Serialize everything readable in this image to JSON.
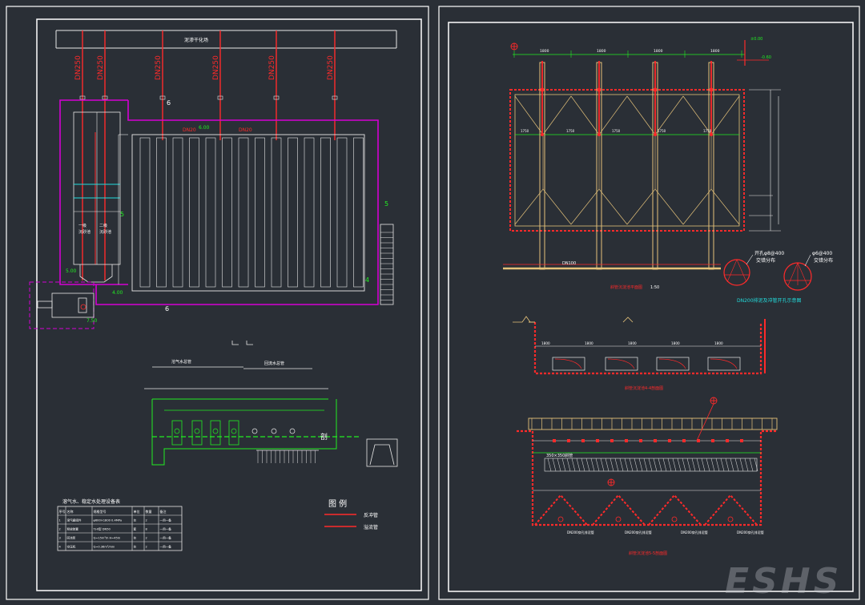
{
  "colors": {
    "background": "#2a2f36",
    "frame": "#ffffff",
    "pipe": "#ff2a2a",
    "basin": "#d400d4",
    "green": "#22ee22",
    "cyan": "#22dddd",
    "wall": "#e5c27a",
    "line": "#e8e8e8"
  },
  "left_sheet": {
    "header_label": "泥渗干化场",
    "pipe_labels": [
      "DN250",
      "DN250",
      "DN250",
      "DN250",
      "DN250",
      "DN250"
    ],
    "dn_labels": [
      "DN20",
      "DN20"
    ],
    "elev_labels": [
      "6.00",
      "5.00",
      "7.50",
      "4.00"
    ],
    "section_marks": [
      "6",
      "6",
      "5",
      "5",
      "4"
    ],
    "chamber_labels": [
      "一级\n沉砂池",
      "二级\n沉砂池"
    ],
    "legend": {
      "title": "图  例",
      "items": [
        {
          "label": "反冲管"
        },
        {
          "label": "溢流管"
        }
      ]
    },
    "table": {
      "title": "溶气水、稳定水处理设备表",
      "headers": [
        "序号",
        "名称",
        "规格型号",
        "单位",
        "数量",
        "备注"
      ],
      "rows": [
        [
          "1",
          "溶气罐组件",
          "φ600×1800 0.4MPa",
          "台",
          "2",
          "一用一备"
        ],
        [
          "2",
          "释放装置",
          "TJ-II型 DN50",
          "套",
          "8",
          "一用一备"
        ],
        [
          "3",
          "回流泵",
          "Q=15m³/h H=45m",
          "台",
          "2",
          "一用一备"
        ],
        [
          "4",
          "空压机",
          "Q=0.36m³/min",
          "台",
          "2",
          "一用一备"
        ]
      ]
    },
    "small_labels": [
      "溶气水总管",
      "回流水总管"
    ]
  },
  "right_sheet": {
    "plan_title": "斜管沉淀池平面图",
    "plan_scale": "1:50",
    "section_1_title": "斜管沉淀池4-4剖面图",
    "section_2_title": "斜管沉淀池5-5剖面图",
    "pipe_note": "DN200排泥及冲管开孔示意图",
    "circle_labels": [
      {
        "l1": "开孔φ8@400",
        "l2": "交错分布"
      },
      {
        "l1": "φ6@400",
        "l2": "交错分布"
      }
    ],
    "dimensions_top": [
      "1800",
      "1800",
      "1800",
      "1800"
    ],
    "dimensions_mid": [
      "1750",
      "1750",
      "1750",
      "1750",
      "1750"
    ],
    "dimensions_section": [
      "1800",
      "1800",
      "1800",
      "1800",
      "1800"
    ],
    "plan_notes": [
      "DN100",
      "DN150排泥管"
    ],
    "elev_marks": [
      "±0.00",
      "-0.60"
    ],
    "section_note": "350×350斜管",
    "pipe_callouts": [
      "DN200穿孔排泥管",
      "DN200穿孔排泥管",
      "DN200穿孔排泥管",
      "DN200穿孔排泥管"
    ]
  },
  "watermark": "ESHS"
}
